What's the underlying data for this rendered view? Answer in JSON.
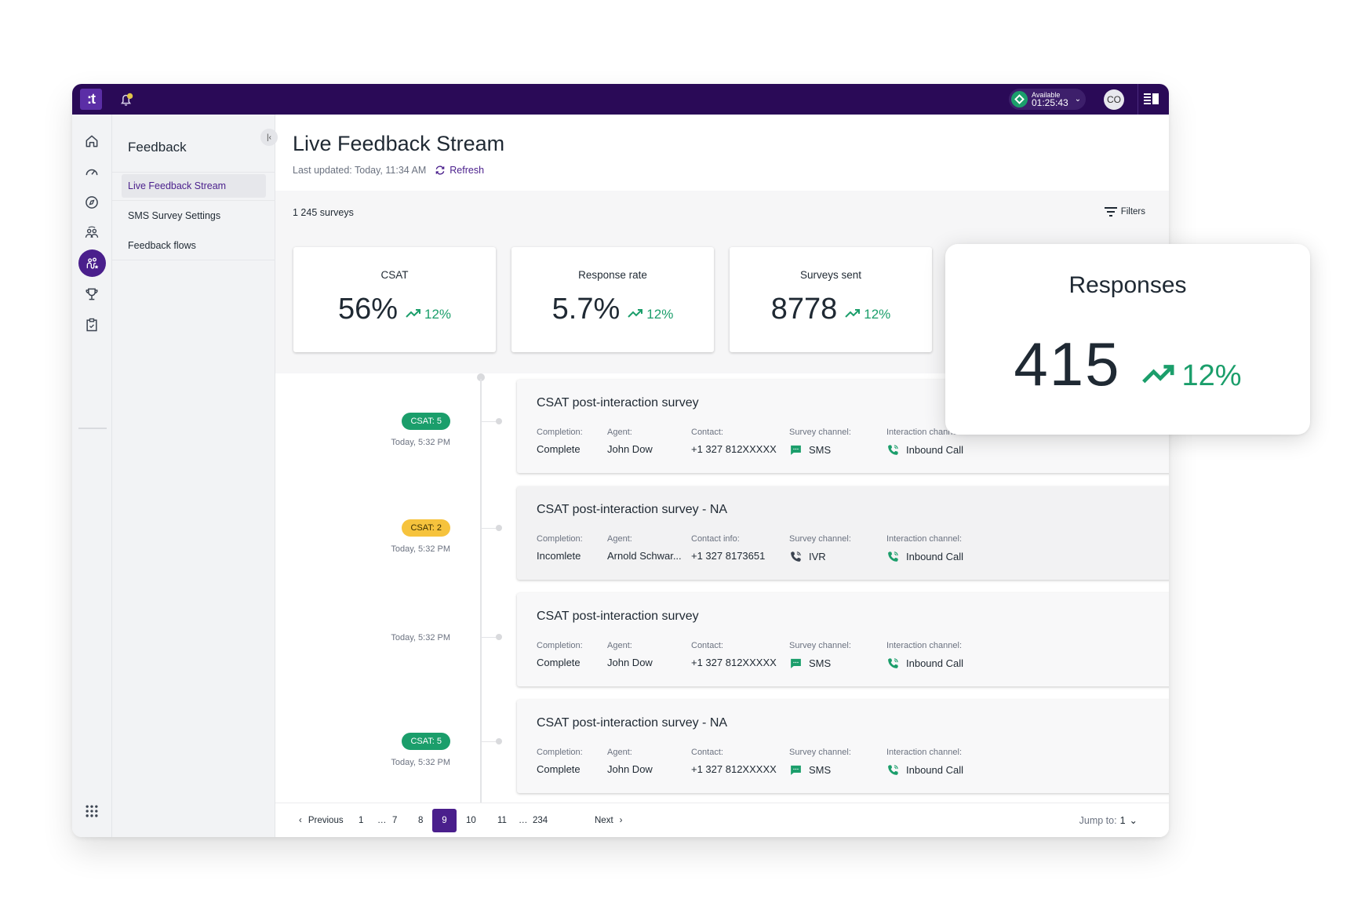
{
  "topbar": {
    "logo_text": ":t",
    "status_label": "Available",
    "status_timer": "01:25:43",
    "avatar_initials": "CO",
    "colors": {
      "bar": "#2a0a57",
      "status": "#1b9e6b"
    }
  },
  "rail": {
    "icons": [
      "home-icon",
      "dashboard-gauge-icon",
      "compass-icon",
      "team-icon",
      "feedback-icon",
      "trophy-icon",
      "clipboard-check-icon"
    ],
    "active": "feedback-icon",
    "bottom_icon": "apps-grid-icon"
  },
  "sidebar": {
    "title": "Feedback",
    "items": [
      {
        "label": "Live Feedback Stream",
        "active": true
      },
      {
        "label": "SMS Survey Settings",
        "active": false
      },
      {
        "label": "Feedback flows",
        "active": false
      }
    ]
  },
  "header": {
    "title": "Live Feedback Stream",
    "last_updated": "Last updated: Today, 11:34 AM",
    "refresh_label": "Refresh"
  },
  "toolbar": {
    "survey_count": "1 245 surveys",
    "filters_label": "Filters"
  },
  "stats": [
    {
      "label": "CSAT",
      "value": "56%",
      "trend": "12%"
    },
    {
      "label": "Response rate",
      "value": "5.7%",
      "trend": "12%"
    },
    {
      "label": "Surveys sent",
      "value": "8778",
      "trend": "12%"
    }
  ],
  "responses": {
    "label": "Responses",
    "value": "415",
    "trend": "12%"
  },
  "field_labels": {
    "completion": "Completion:",
    "agent": "Agent:",
    "survey_channel": "Survey channel:",
    "interaction_channel": "Interaction channel:"
  },
  "entries": [
    {
      "badge": "CSAT: 5",
      "badge_color": "green",
      "time": "Today, 5:32 PM",
      "title": "CSAT post-interaction survey",
      "completion": "Complete",
      "agent": "John Dow",
      "contact_label": "Contact:",
      "contact": "+1 327 812XXXXX",
      "survey_channel": "SMS",
      "survey_channel_icon": "sms-icon",
      "interaction_channel": "Inbound Call"
    },
    {
      "badge": "CSAT: 2",
      "badge_color": "yellow",
      "time": "Today, 5:32 PM",
      "title": "CSAT post-interaction survey - NA",
      "completion": "Incomlete",
      "agent": "Arnold Schwar...",
      "contact_label": "Contact info:",
      "contact": "+1 327 8173651",
      "survey_channel": "IVR",
      "survey_channel_icon": "phone-icon",
      "interaction_channel": "Inbound Call"
    },
    {
      "badge": null,
      "badge_color": null,
      "time": "Today, 5:32 PM",
      "title": "CSAT post-interaction survey",
      "completion": "Complete",
      "agent": "John Dow",
      "contact_label": "Contact:",
      "contact": "+1 327 812XXXXX",
      "survey_channel": "SMS",
      "survey_channel_icon": "sms-icon",
      "interaction_channel": "Inbound Call"
    },
    {
      "badge": "CSAT: 5",
      "badge_color": "green",
      "time": "Today, 5:32 PM",
      "title": "CSAT post-interaction survey - NA",
      "completion": "Complete",
      "agent": "John Dow",
      "contact_label": "Contact:",
      "contact": "+1 327 812XXXXX",
      "survey_channel": "SMS",
      "survey_channel_icon": "sms-icon",
      "interaction_channel": "Inbound Call"
    }
  ],
  "pagination": {
    "previous": "Previous",
    "next": "Next",
    "pages": [
      "1",
      "…",
      "7",
      "8",
      "9",
      "10",
      "11",
      "…",
      "234"
    ],
    "current": "9",
    "jump_label": "Jump to:",
    "jump_value": "1"
  }
}
